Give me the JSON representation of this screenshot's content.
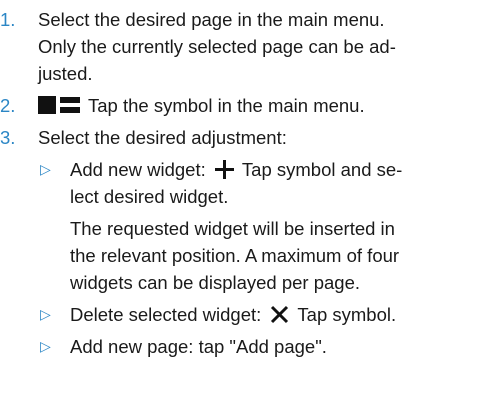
{
  "steps": [
    {
      "number": "1.",
      "lines": [
        "Select the desired page in the main menu.",
        "Only the currently selected page can be ad-",
        "justed."
      ]
    },
    {
      "number": "2.",
      "icon": "main-menu-icon",
      "text": "Tap the symbol in the main menu."
    },
    {
      "number": "3.",
      "text": "Select the desired adjustment:"
    }
  ],
  "sub_items": {
    "add_widget": {
      "bullet": "▷",
      "lead": "Add new widget:",
      "icon": "plus-icon",
      "line1_rest": "Tap symbol and se-",
      "line2": "lect desired widget."
    },
    "note": {
      "lines": [
        "The requested widget will be inserted in",
        "the relevant position. A maximum of four",
        "widgets can be displayed per page."
      ]
    },
    "delete_widget": {
      "bullet": "▷",
      "lead": "Delete selected widget:",
      "icon": "close-icon",
      "rest": "Tap symbol."
    },
    "add_page": {
      "bullet": "▷",
      "text": "Add new page: tap \"Add page\"."
    }
  },
  "colors": {
    "accent": "#2b86c5",
    "text": "#1a1a1a"
  }
}
